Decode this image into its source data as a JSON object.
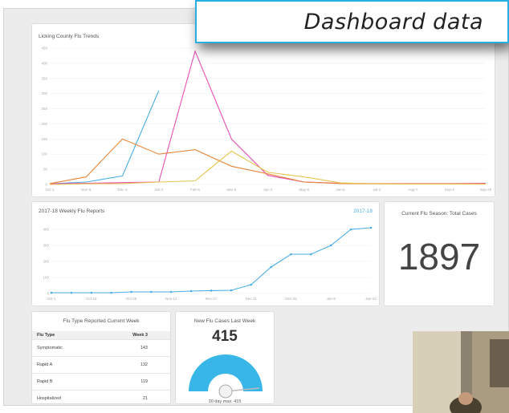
{
  "banner": {
    "text": "Dashboard data"
  },
  "trends": {
    "title": "Licking County Flu Trends",
    "y_ticks": [
      "450",
      "400",
      "350",
      "300",
      "250",
      "200",
      "150",
      "100",
      "50",
      "0"
    ],
    "x_ticks": [
      "Oct-1",
      "Nov-6",
      "Dec-4",
      "Jan-2",
      "Feb-6",
      "Mar-6",
      "Apr-3",
      "May-8",
      "Jun-5",
      "Jul-3",
      "Aug-7",
      "Sep-4",
      "Sep-25"
    ]
  },
  "weekly": {
    "title": "2017-18 Weekly Flu Reports",
    "legend": "2017-18",
    "y_ticks": [
      "400",
      "300",
      "200",
      "100",
      "0"
    ],
    "x_ticks": [
      "Oct-1",
      "Oct-15",
      "Oct-29",
      "Nov-12",
      "Nov-27",
      "Dec-11",
      "Dec-25",
      "Jan-8",
      "Jan-23"
    ]
  },
  "total": {
    "title": "Current Flu Season: Total Cases",
    "value": "1897"
  },
  "flu_type": {
    "title": "Flu Type Reported Current Week",
    "col1": "Flu Type",
    "col2": "Week 3",
    "rows": [
      {
        "type": "Symptomatic",
        "count": "143"
      },
      {
        "type": "Rapid A",
        "count": "132"
      },
      {
        "type": "Rapid B",
        "count": "119"
      },
      {
        "type": "Hospitalized",
        "count": "21"
      }
    ]
  },
  "new_cases": {
    "title": "New Flu Cases Last Week",
    "value": "415",
    "max_text": "30 day max: 415",
    "fraction": 1.0
  },
  "chart_data": [
    {
      "type": "line",
      "title": "Licking County Flu Trends",
      "ylim": [
        0,
        450
      ],
      "x": [
        "Oct-1",
        "Nov-6",
        "Dec-4",
        "Jan-2",
        "Feb-6",
        "Mar-6",
        "Apr-3",
        "May-8",
        "Jun-5",
        "Jul-3",
        "Aug-7",
        "Sep-4",
        "Sep-25"
      ],
      "series": [
        {
          "color": "#4aaee6",
          "values": [
            2,
            8,
            28,
            310,
            null,
            null,
            null,
            null,
            null,
            null,
            null,
            null,
            null
          ]
        },
        {
          "color": "#e84fb5",
          "values": [
            2,
            4,
            6,
            8,
            440,
            150,
            30,
            8,
            4,
            3,
            3,
            3,
            4
          ]
        },
        {
          "color": "#e8873a",
          "values": [
            3,
            25,
            150,
            100,
            115,
            60,
            35,
            8,
            3,
            2,
            2,
            2,
            2
          ]
        },
        {
          "color": "#e6c44d",
          "values": [
            0,
            2,
            3,
            8,
            12,
            110,
            40,
            25,
            5,
            2,
            1,
            1,
            1
          ]
        }
      ]
    },
    {
      "type": "line",
      "title": "2017-18 Weekly Flu Reports",
      "ylim": [
        0,
        450
      ],
      "x": [
        "Oct-1",
        "Oct-15",
        "Oct-29",
        "Nov-12",
        "Nov-27",
        "Dec-11",
        "Dec-25",
        "Jan-8",
        "Jan-23"
      ],
      "series": [
        {
          "name": "2017-18",
          "color": "#4aaee6",
          "values": [
            5,
            5,
            5,
            5,
            10,
            10,
            10,
            15,
            18,
            20,
            55,
            165,
            245,
            245,
            300,
            400,
            410
          ]
        }
      ]
    }
  ]
}
